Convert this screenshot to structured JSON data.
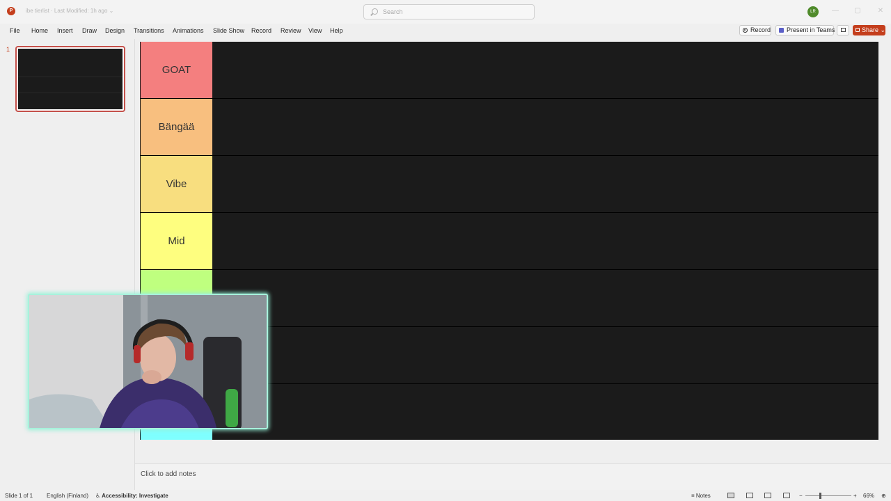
{
  "titlebar": {
    "doc_title": "ibe tierlist  ·  Last Modified: 1h ago ⌄",
    "search_placeholder": "Search",
    "avatar_initials": "LR",
    "minimize": "—",
    "restore": "▢",
    "close": "✕"
  },
  "menu": [
    "File",
    "Home",
    "Insert",
    "Draw",
    "Design",
    "Transitions",
    "Animations",
    "Slide Show",
    "Record",
    "Review",
    "View",
    "Help"
  ],
  "ribbon_buttons": {
    "record": "Record",
    "present": "Present in Teams",
    "share": "Share ⌄"
  },
  "thumbnail": {
    "number": "1"
  },
  "tiers": [
    {
      "label": "GOAT",
      "color": "#f47f7f"
    },
    {
      "label": "Bängää",
      "color": "#f8bf7f"
    },
    {
      "label": "Vibe",
      "color": "#f8de7f"
    },
    {
      "label": "Mid",
      "color": "#fefe7f"
    },
    {
      "label": "",
      "color": "#bfff7f"
    },
    {
      "label": "",
      "color": "#7fff7f"
    },
    {
      "label": "",
      "color": "#7fffff"
    }
  ],
  "notes": {
    "placeholder": "Click to add notes"
  },
  "statusbar": {
    "slide": "Slide 1 of 1",
    "language": "English (Finland)",
    "accessibility": "Accessibility: Investigate",
    "notes": "Notes",
    "zoom": "66%"
  },
  "colors": {
    "accent": "#c43e1c",
    "webcam_border": "#a7f2dc",
    "slide_bg": "#1b1b1b"
  }
}
